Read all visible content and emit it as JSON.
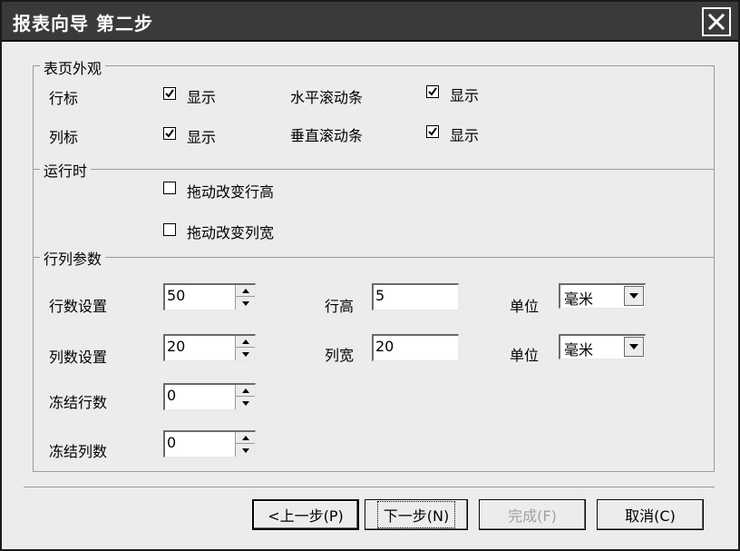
{
  "window": {
    "title": "报表向导 第二步"
  },
  "appearance": {
    "legend": "表页外观",
    "row_header_label": "行标",
    "row_header_checked": true,
    "row_header_check_label": "显示",
    "hscroll_label": "水平滚动条",
    "hscroll_checked": true,
    "hscroll_check_label": "显示",
    "col_header_label": "列标",
    "col_header_checked": true,
    "col_header_check_label": "显示",
    "vscroll_label": "垂直滚动条",
    "vscroll_checked": true,
    "vscroll_check_label": "显示"
  },
  "runtime": {
    "legend": "运行时",
    "drag_row_height_label": "拖动改变行高",
    "drag_row_height_checked": false,
    "drag_col_width_label": "拖动改变列宽",
    "drag_col_width_checked": false
  },
  "params": {
    "legend": "行列参数",
    "row_count_label": "行数设置",
    "row_count_value": "50",
    "col_count_label": "列数设置",
    "col_count_value": "20",
    "freeze_rows_label": "冻结行数",
    "freeze_rows_value": "0",
    "freeze_cols_label": "冻结列数",
    "freeze_cols_value": "0",
    "row_height_label": "行高",
    "row_height_value": "5",
    "col_width_label": "列宽",
    "col_width_value": "20",
    "unit_label_1": "单位",
    "unit_value_1": "毫米",
    "unit_label_2": "单位",
    "unit_value_2": "毫米"
  },
  "buttons": {
    "prev": "<上一步(P)",
    "next": "下一步(N)",
    "finish": "完成(F)",
    "cancel": "取消(C)"
  }
}
